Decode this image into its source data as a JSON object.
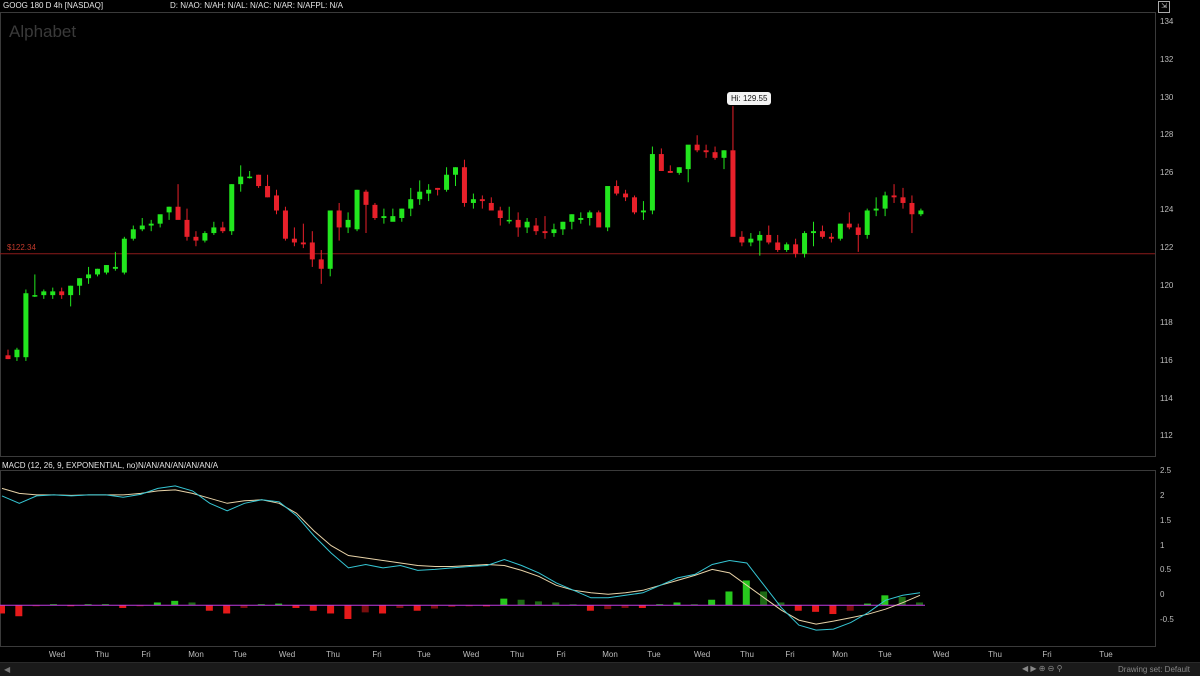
{
  "header": {
    "symbol_info": "GOOG 180 D 4h [NASDAQ]",
    "study_values": "D: N/AO: N/AH: N/AL: N/AC: N/AR: N/AFPL: N/A",
    "watermark": "Alphabet"
  },
  "price_panel": {
    "y_ticks": [
      "134",
      "132",
      "130",
      "128",
      "126",
      "124",
      "122",
      "120",
      "118",
      "116",
      "114",
      "112"
    ],
    "y_values": [
      134,
      132,
      130,
      128,
      126,
      124,
      122,
      120,
      118,
      116,
      114,
      112
    ],
    "ylim": [
      111,
      134.5
    ],
    "horizontal_line": {
      "label": "$122.34",
      "value": 121.7,
      "color": "#8b1a1a"
    },
    "hi_label": "Hi: 129.55"
  },
  "macd_panel": {
    "title": "MACD (12, 26, 9, EXPONENTIAL, no)N/AN/AN/AN/AN/AN/A",
    "y_ticks": [
      "2.5",
      "2",
      "1.5",
      "1",
      "0.5",
      "0",
      "-0.5"
    ],
    "y_values": [
      2.5,
      2,
      1.5,
      1,
      0.5,
      0,
      -0.5
    ],
    "ylim": [
      -1.0,
      2.5
    ]
  },
  "x_axis": {
    "labels": [
      "Wed",
      "Thu",
      "Fri",
      "Mon",
      "Tue",
      "Wed",
      "Thu",
      "Fri",
      "Tue",
      "Wed",
      "Thu",
      "Fri",
      "Mon",
      "Tue",
      "Wed",
      "Thu",
      "Fri",
      "Mon",
      "Tue",
      "Wed",
      "Thu",
      "Fri",
      "Tue"
    ]
  },
  "status_bar": {
    "drawing_text": "Drawing set: Default"
  },
  "colors": {
    "up": "#22e61e",
    "down": "#e8202a",
    "macd_line": "#35c6d4",
    "signal_line": "#e8d3a8",
    "hist_up": "#27c81d",
    "hist_up_dim": "#1d6b14",
    "hist_down": "#e61a1a",
    "hist_down_dim": "#7a0e0e",
    "zero_line": "#c03adf"
  },
  "chart_data": [
    {
      "type": "candlestick",
      "title": "GOOG 180 D 4h [NASDAQ]",
      "candles": [
        [
          116.3,
          116.6,
          116.1,
          116.1
        ],
        [
          116.2,
          116.7,
          116.0,
          116.6
        ],
        [
          116.2,
          119.8,
          116.0,
          119.6
        ],
        [
          119.5,
          120.6,
          119.4,
          119.5
        ],
        [
          119.5,
          119.8,
          119.3,
          119.7
        ],
        [
          119.5,
          119.9,
          119.3,
          119.7
        ],
        [
          119.7,
          119.9,
          119.3,
          119.5
        ],
        [
          119.5,
          120.0,
          118.9,
          120.0
        ],
        [
          120.0,
          120.4,
          119.5,
          120.4
        ],
        [
          120.4,
          121.0,
          120.1,
          120.6
        ],
        [
          120.6,
          120.9,
          120.5,
          120.9
        ],
        [
          120.7,
          121.1,
          120.6,
          121.1
        ],
        [
          120.9,
          121.8,
          120.8,
          121.0
        ],
        [
          120.7,
          122.6,
          120.6,
          122.5
        ],
        [
          122.5,
          123.2,
          122.4,
          123.0
        ],
        [
          123.0,
          123.6,
          122.9,
          123.2
        ],
        [
          123.2,
          123.5,
          122.9,
          123.3
        ],
        [
          123.3,
          123.7,
          123.1,
          123.8
        ],
        [
          123.9,
          124.2,
          123.5,
          124.2
        ],
        [
          124.2,
          125.4,
          123.9,
          123.5
        ],
        [
          123.5,
          124.1,
          122.4,
          122.6
        ],
        [
          122.6,
          122.9,
          122.1,
          122.4
        ],
        [
          122.4,
          122.9,
          122.3,
          122.8
        ],
        [
          122.8,
          123.4,
          122.7,
          123.1
        ],
        [
          123.1,
          123.4,
          122.8,
          122.9
        ],
        [
          122.9,
          125.4,
          122.7,
          125.4
        ],
        [
          125.4,
          126.4,
          125.0,
          125.8
        ],
        [
          125.8,
          126.1,
          125.7,
          125.8
        ],
        [
          125.9,
          125.9,
          125.2,
          125.3
        ],
        [
          125.3,
          125.9,
          124.7,
          124.7
        ],
        [
          124.8,
          125.1,
          123.8,
          124.0
        ],
        [
          124.0,
          124.2,
          122.4,
          122.5
        ],
        [
          122.5,
          123.1,
          122.1,
          122.3
        ],
        [
          122.3,
          123.3,
          122.0,
          122.2
        ],
        [
          122.3,
          122.9,
          121.0,
          121.4
        ],
        [
          121.4,
          121.9,
          120.1,
          120.9
        ],
        [
          120.9,
          122.7,
          120.5,
          124.0
        ],
        [
          124.0,
          124.4,
          122.4,
          123.1
        ],
        [
          123.1,
          123.9,
          122.8,
          123.5
        ],
        [
          123.0,
          125.1,
          122.9,
          125.1
        ],
        [
          125.0,
          125.1,
          122.8,
          124.3
        ],
        [
          124.3,
          124.4,
          123.5,
          123.6
        ],
        [
          123.6,
          124.1,
          123.3,
          123.7
        ],
        [
          123.4,
          124.1,
          123.5,
          123.7
        ],
        [
          123.6,
          124.1,
          123.4,
          124.1
        ],
        [
          124.1,
          125.2,
          123.7,
          124.6
        ],
        [
          124.6,
          125.6,
          124.3,
          125.0
        ],
        [
          124.9,
          125.4,
          124.5,
          125.1
        ],
        [
          125.2,
          125.2,
          124.8,
          125.1
        ],
        [
          125.1,
          126.3,
          125.0,
          125.9
        ],
        [
          125.9,
          126.3,
          125.3,
          126.3
        ],
        [
          126.3,
          126.7,
          124.2,
          124.4
        ],
        [
          124.4,
          124.9,
          124.1,
          124.6
        ],
        [
          124.6,
          124.8,
          124.1,
          124.5
        ],
        [
          124.4,
          124.7,
          124.1,
          124.0
        ],
        [
          124.0,
          124.2,
          123.2,
          123.6
        ],
        [
          123.5,
          124.2,
          123.3,
          123.5
        ],
        [
          123.5,
          123.9,
          122.6,
          123.1
        ],
        [
          123.1,
          123.6,
          122.8,
          123.4
        ],
        [
          123.2,
          123.6,
          122.7,
          122.9
        ],
        [
          122.9,
          123.7,
          122.5,
          122.8
        ],
        [
          122.8,
          123.3,
          122.6,
          123.0
        ],
        [
          123.0,
          123.4,
          122.7,
          123.4
        ],
        [
          123.4,
          123.8,
          123.0,
          123.8
        ],
        [
          123.5,
          123.9,
          123.3,
          123.6
        ],
        [
          123.6,
          124.0,
          123.2,
          123.9
        ],
        [
          123.9,
          124.0,
          123.2,
          123.1
        ],
        [
          123.1,
          125.2,
          122.9,
          125.3
        ],
        [
          125.3,
          125.6,
          124.8,
          124.9
        ],
        [
          124.9,
          125.1,
          124.5,
          124.7
        ],
        [
          124.7,
          124.8,
          123.8,
          123.9
        ],
        [
          123.9,
          124.5,
          123.5,
          124.0
        ],
        [
          124.0,
          127.4,
          123.8,
          127.0
        ],
        [
          127.0,
          127.3,
          126.1,
          126.1
        ],
        [
          126.1,
          126.4,
          126.0,
          126.0
        ],
        [
          126.0,
          126.3,
          125.9,
          126.3
        ],
        [
          126.2,
          126.4,
          125.5,
          127.5
        ],
        [
          127.5,
          128.0,
          127.1,
          127.2
        ],
        [
          127.2,
          127.5,
          126.8,
          127.1
        ],
        [
          127.1,
          127.4,
          126.7,
          126.8
        ],
        [
          126.8,
          127.2,
          126.2,
          127.2
        ],
        [
          127.2,
          129.55,
          127.0,
          122.6
        ],
        [
          122.6,
          122.9,
          122.1,
          122.3
        ],
        [
          122.3,
          122.8,
          122.1,
          122.5
        ],
        [
          122.4,
          122.9,
          121.6,
          122.7
        ],
        [
          122.7,
          123.2,
          122.2,
          122.3
        ],
        [
          122.3,
          122.7,
          121.8,
          121.9
        ],
        [
          121.9,
          122.3,
          121.8,
          122.2
        ],
        [
          122.2,
          122.5,
          121.5,
          121.7
        ],
        [
          121.7,
          122.9,
          121.5,
          122.8
        ],
        [
          122.8,
          123.4,
          122.1,
          122.9
        ],
        [
          122.9,
          123.2,
          122.5,
          122.6
        ],
        [
          122.6,
          122.8,
          122.3,
          122.5
        ],
        [
          122.5,
          123.3,
          122.4,
          123.3
        ],
        [
          123.3,
          123.9,
          123.0,
          123.1
        ],
        [
          123.1,
          123.3,
          121.8,
          122.7
        ],
        [
          122.7,
          124.1,
          122.5,
          124.0
        ],
        [
          124.0,
          124.7,
          123.7,
          124.1
        ],
        [
          124.1,
          125.0,
          123.7,
          124.8
        ],
        [
          124.8,
          125.4,
          124.4,
          124.7
        ],
        [
          124.7,
          125.2,
          124.1,
          124.4
        ],
        [
          124.4,
          124.8,
          122.8,
          123.8
        ],
        [
          123.8,
          124.1,
          123.7,
          124.0
        ]
      ]
    },
    {
      "type": "line",
      "title": "MACD (12, 26, 9, EXPONENTIAL, no)",
      "series": [
        {
          "name": "MACD",
          "values": [
            2.0,
            1.85,
            2.0,
            2.02,
            2.0,
            2.02,
            2.02,
            1.97,
            2.03,
            2.15,
            2.2,
            2.1,
            1.85,
            1.7,
            1.85,
            1.92,
            1.88,
            1.6,
            1.2,
            0.85,
            0.55,
            0.62,
            0.55,
            0.6,
            0.5,
            0.52,
            0.55,
            0.58,
            0.6,
            0.72,
            0.6,
            0.45,
            0.25,
            0.1,
            -0.05,
            -0.05,
            0.0,
            0.05,
            0.2,
            0.35,
            0.42,
            0.62,
            0.7,
            0.65,
            0.2,
            -0.25,
            -0.6,
            -0.7,
            -0.68,
            -0.55,
            -0.35,
            -0.1,
            0.0,
            0.05
          ]
        },
        {
          "name": "Signal",
          "values": [
            2.15,
            2.05,
            2.02,
            2.02,
            2.01,
            2.02,
            2.02,
            2.02,
            2.05,
            2.1,
            2.12,
            2.05,
            1.95,
            1.85,
            1.9,
            1.92,
            1.85,
            1.65,
            1.3,
            1.0,
            0.8,
            0.75,
            0.7,
            0.65,
            0.6,
            0.58,
            0.58,
            0.6,
            0.62,
            0.6,
            0.5,
            0.38,
            0.2,
            0.1,
            0.05,
            0.02,
            0.05,
            0.1,
            0.2,
            0.3,
            0.4,
            0.52,
            0.45,
            0.2,
            -0.05,
            -0.3,
            -0.5,
            -0.58,
            -0.52,
            -0.45,
            -0.38,
            -0.28,
            -0.15,
            0.0
          ]
        }
      ]
    }
  ]
}
